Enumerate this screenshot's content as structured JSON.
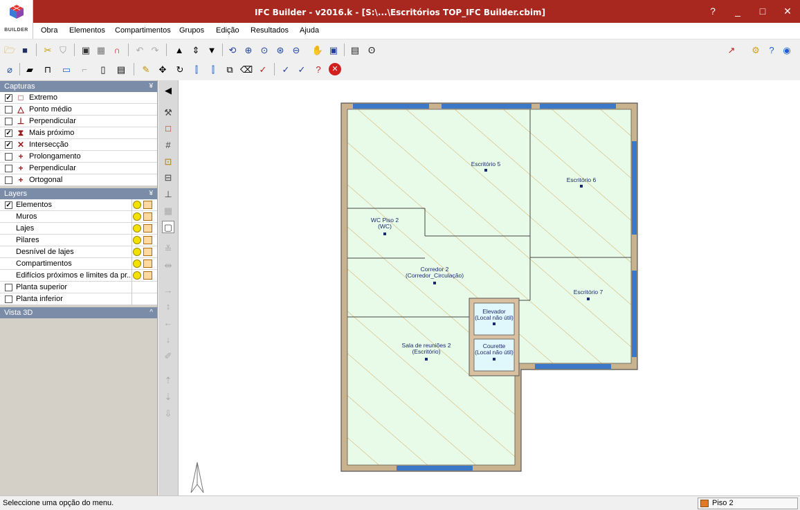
{
  "window": {
    "title": "IFC Builder - v2016.k - [S:\\...\\Escritórios TOP_IFC Builder.cbim]",
    "help": "?",
    "minimize": "_",
    "maximize": "□",
    "close": "✕",
    "logo_text": "BUILDER"
  },
  "menu": [
    "Obra",
    "Elementos",
    "Compartimentos",
    "Grupos",
    "Edição",
    "Resultados",
    "Ajuda"
  ],
  "capturas": {
    "title": "Capturas",
    "items": [
      {
        "label": "Extremo",
        "checked": true,
        "icon": "□"
      },
      {
        "label": "Ponto médio",
        "checked": false,
        "icon": "△"
      },
      {
        "label": "Perpendicular",
        "checked": false,
        "icon": "⊥"
      },
      {
        "label": "Mais próximo",
        "checked": true,
        "icon": "⧗"
      },
      {
        "label": "Intersecção",
        "checked": true,
        "icon": "✕"
      },
      {
        "label": "Prolongamento",
        "checked": false,
        "icon": "+"
      },
      {
        "label": "Perpendicular",
        "checked": false,
        "icon": "+"
      },
      {
        "label": "Ortogonal",
        "checked": false,
        "icon": "+"
      }
    ]
  },
  "layers": {
    "title": "Layers",
    "items": [
      {
        "label": "Elementos",
        "checked": true,
        "indent": false
      },
      {
        "label": "Muros",
        "indent": true
      },
      {
        "label": "Lajes",
        "indent": true
      },
      {
        "label": "Pilares",
        "indent": true
      },
      {
        "label": "Desnível de lajes",
        "indent": true
      },
      {
        "label": "Compartimentos",
        "indent": true
      },
      {
        "label": "Edifícios próximos e limites da pr...",
        "indent": true
      },
      {
        "label": "Planta superior",
        "checked": false,
        "indent": false
      },
      {
        "label": "Planta inferior",
        "checked": false,
        "indent": false
      }
    ]
  },
  "vista3d": {
    "title": "Vista 3D"
  },
  "rooms": [
    {
      "name": "Escritório 5",
      "type": ""
    },
    {
      "name": "Escritório 6",
      "type": ""
    },
    {
      "name": "WC Piso 2",
      "type": "(WC)"
    },
    {
      "name": "Corredor 2",
      "type": "(Corredor_Circulação)"
    },
    {
      "name": "Escritório 7",
      "type": ""
    },
    {
      "name": "Elevador",
      "type": "(Local não útil)"
    },
    {
      "name": "Sala de reuniões 2",
      "type": "(Escritório)"
    },
    {
      "name": "Courette",
      "type": "(Local não útil)"
    }
  ],
  "status": {
    "message": "Seleccione uma opção do menu.",
    "floor": "Piso 2"
  },
  "colors": {
    "titlebar": "#a8271e",
    "room_fill": "#e6fae6",
    "wall": "#c9b38e",
    "window": "#3c78c8",
    "panel_header": "#7b8ca8"
  }
}
